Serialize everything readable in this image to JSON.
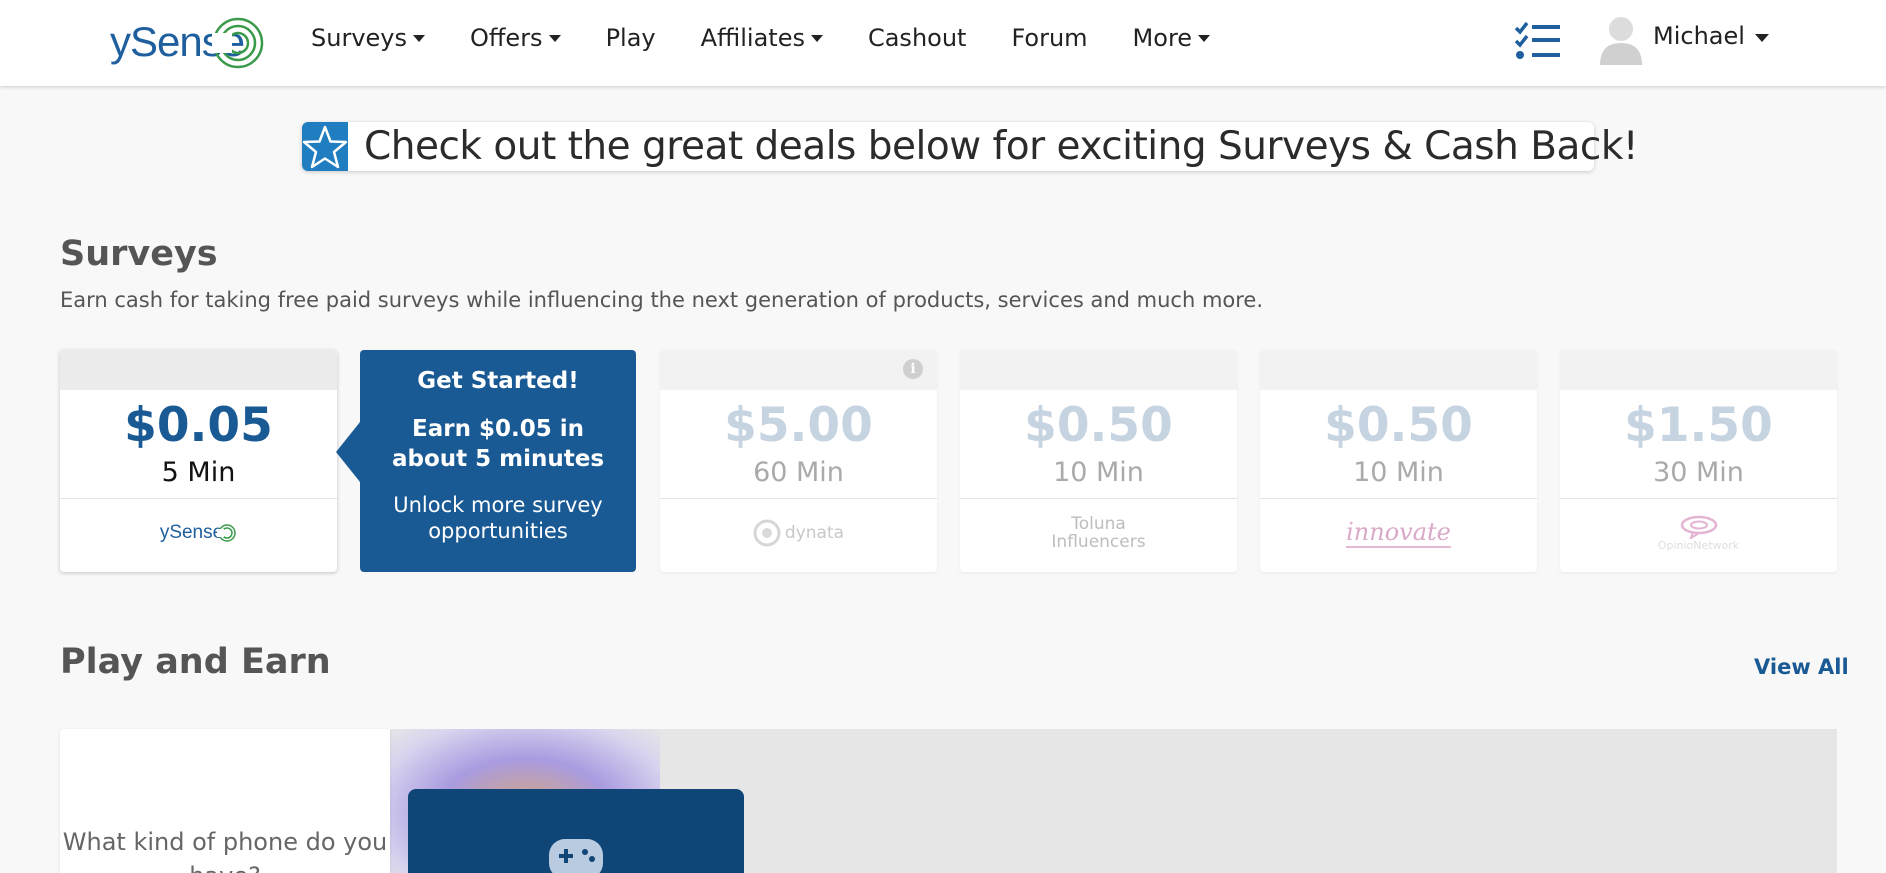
{
  "header": {
    "logo_text": "ySense",
    "nav": [
      {
        "label": "Surveys",
        "dropdown": true
      },
      {
        "label": "Offers",
        "dropdown": true
      },
      {
        "label": "Play",
        "dropdown": false
      },
      {
        "label": "Affiliates",
        "dropdown": true
      },
      {
        "label": "Cashout",
        "dropdown": false
      },
      {
        "label": "Forum",
        "dropdown": false
      },
      {
        "label": "More",
        "dropdown": true
      }
    ],
    "user_name": "Michael",
    "icons": [
      "tasks-list-icon",
      "user-avatar-icon",
      "chevron-down-icon"
    ]
  },
  "banner": {
    "text": "Check out the great deals below for exciting Surveys & Cash Back!",
    "icon": "star-icon"
  },
  "surveys": {
    "title": "Surveys",
    "subtitle": "Earn cash for taking free paid surveys while influencing the next generation of products, services and much more.",
    "cards": [
      {
        "amount": "$0.05",
        "minutes": "5 Min",
        "provider": "ySense",
        "active": true
      },
      {
        "amount": "$5.00",
        "minutes": "60 Min",
        "provider": "dynata",
        "active": false
      },
      {
        "amount": "$0.50",
        "minutes": "10 Min",
        "provider": "Toluna Influencers",
        "active": false
      },
      {
        "amount": "$0.50",
        "minutes": "10 Min",
        "provider": "innovate",
        "active": false
      },
      {
        "amount": "$1.50",
        "minutes": "30 Min",
        "provider": "OpinioNetwork",
        "active": false
      }
    ],
    "get_started": {
      "title": "Get Started!",
      "earn": "Earn $0.05 in about 5 minutes",
      "unlock": "Unlock more survey opportunities"
    }
  },
  "play": {
    "title": "Play and Earn",
    "view_all": "View All",
    "phone_question": "What kind of phone do you have?"
  },
  "colors": {
    "brand_blue": "#1a5a94",
    "banner_blue": "#1f7dc0",
    "logo_green": "#3a9a4a"
  }
}
